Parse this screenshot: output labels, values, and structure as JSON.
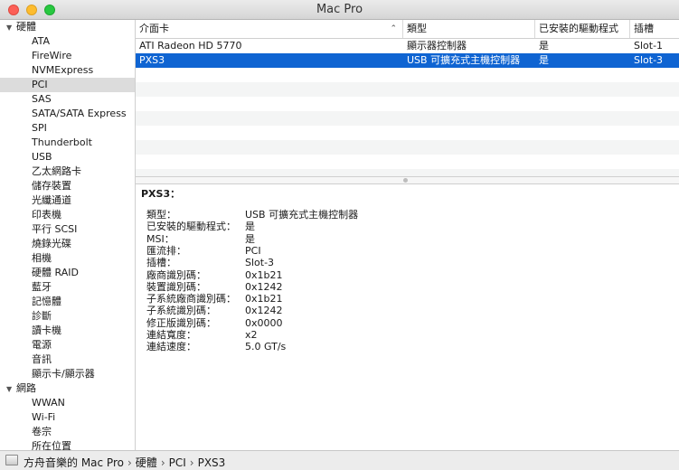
{
  "window": {
    "title": "Mac Pro"
  },
  "sidebar": {
    "groups": [
      {
        "label": "硬體",
        "expanded": true,
        "items": [
          "ATA",
          "FireWire",
          "NVMExpress",
          "PCI",
          "SAS",
          "SATA/SATA Express",
          "SPI",
          "Thunderbolt",
          "USB",
          "乙太網路卡",
          "儲存裝置",
          "光纖通道",
          "印表機",
          "平行 SCSI",
          "燒錄光碟",
          "相機",
          "硬體 RAID",
          "藍牙",
          "記憶體",
          "診斷",
          "讀卡機",
          "電源",
          "音訊",
          "顯示卡/顯示器"
        ]
      },
      {
        "label": "網路",
        "expanded": true,
        "items": [
          "WWAN",
          "Wi-Fi",
          "卷宗",
          "所在位置"
        ]
      }
    ],
    "selected": "PCI"
  },
  "table": {
    "columns": [
      {
        "label": "介面卡",
        "sorted": true
      },
      {
        "label": "類型"
      },
      {
        "label": "已安裝的驅動程式"
      },
      {
        "label": "插槽"
      }
    ],
    "rows": [
      [
        "ATI Radeon HD 5770",
        "顯示器控制器",
        "是",
        "Slot-1"
      ],
      [
        "PXS3",
        "USB 可擴充式主機控制器",
        "是",
        "Slot-3"
      ]
    ],
    "selected_row": 1,
    "sort_icon": "chevron-up"
  },
  "detail": {
    "title": "PXS3：",
    "fields": [
      {
        "key": "類型：",
        "value": "USB 可擴充式主機控制器"
      },
      {
        "key": "已安裝的驅動程式：",
        "value": "是"
      },
      {
        "key": "MSI：",
        "value": "是"
      },
      {
        "key": "匯流排：",
        "value": "PCI"
      },
      {
        "key": "插槽：",
        "value": "Slot-3"
      },
      {
        "key": "廠商識別碼：",
        "value": "0x1b21"
      },
      {
        "key": "裝置識別碼：",
        "value": "0x1242"
      },
      {
        "key": "子系統廠商識別碼：",
        "value": "0x1b21"
      },
      {
        "key": "子系統識別碼：",
        "value": "0x1242"
      },
      {
        "key": "修正版識別碼：",
        "value": "0x0000"
      },
      {
        "key": "連結寬度：",
        "value": "x2"
      },
      {
        "key": "連結速度：",
        "value": "5.0 GT/s"
      }
    ]
  },
  "statusbar": {
    "icon": "computer-icon",
    "breadcrumb": [
      "方舟音樂的 Mac Pro",
      "硬體",
      "PCI",
      "PXS3"
    ],
    "separator": "›"
  },
  "colors": {
    "selection": "#0f64d2",
    "sidebar_selection": "#dcdcdc"
  }
}
